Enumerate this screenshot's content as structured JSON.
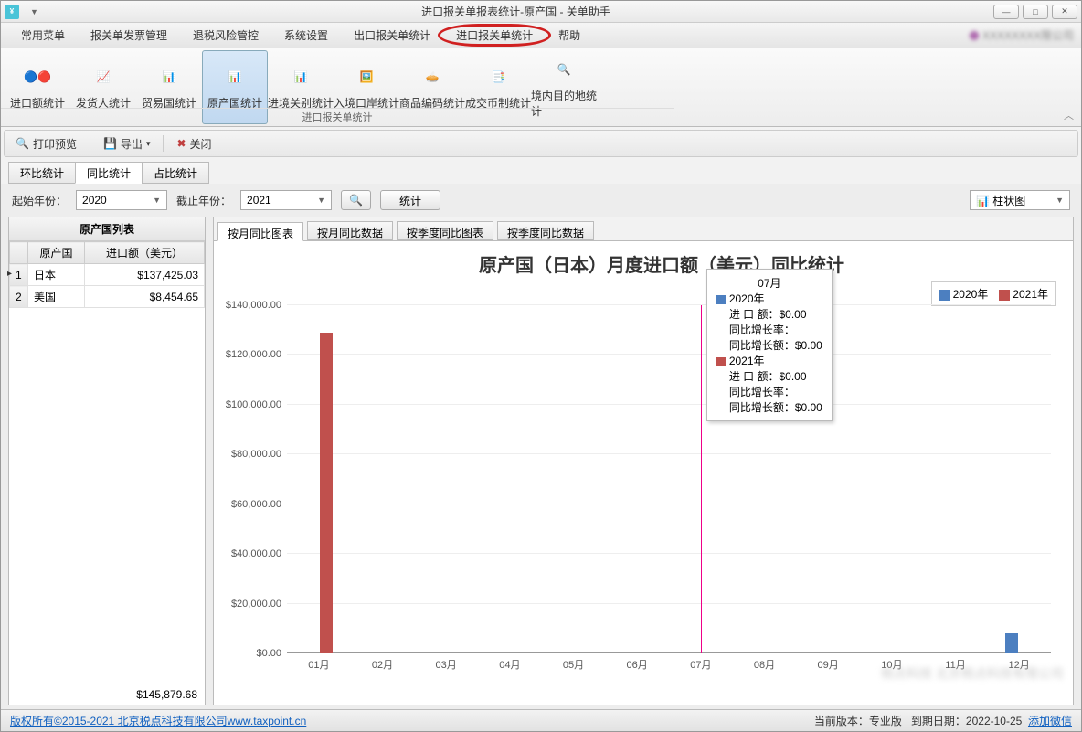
{
  "window": {
    "title": "进口报关单报表统计-原产国 - 关单助手"
  },
  "menubar": {
    "items": [
      "常用菜单",
      "报关单发票管理",
      "退税风险管控",
      "系统设置",
      "出口报关单统计",
      "进口报关单统计",
      "帮助"
    ],
    "highlight_index": 5,
    "company": "XXXXXXXX限公司"
  },
  "ribbon": {
    "buttons": [
      "进口额统计",
      "发货人统计",
      "贸易国统计",
      "原产国统计",
      "进境关别统计",
      "入境口岸统计",
      "商品编码统计",
      "成交币制统计",
      "境内目的地统计"
    ],
    "active_index": 3,
    "group_label": "进口报关单统计"
  },
  "toolbar": {
    "print": "打印预览",
    "export": "导出",
    "close": "关闭"
  },
  "tabs1": {
    "items": [
      "环比统计",
      "同比统计",
      "占比统计"
    ],
    "active": 1
  },
  "filter": {
    "start_label": "起始年份：",
    "start_value": "2020",
    "end_label": "截止年份：",
    "end_value": "2021",
    "stat_btn": "统计",
    "chart_type": "柱状图"
  },
  "left": {
    "title": "原产国列表",
    "col_country": "原产国",
    "col_amount": "进口额（美元）",
    "rows": [
      {
        "idx": "1",
        "country": "日本",
        "amount": "$137,425.03"
      },
      {
        "idx": "2",
        "country": "美国",
        "amount": "$8,454.65"
      }
    ],
    "total": "$145,879.68"
  },
  "tabs2": {
    "items": [
      "按月同比图表",
      "按月同比数据",
      "按季度同比图表",
      "按季度同比数据"
    ],
    "active": 0
  },
  "chart_data": {
    "type": "bar",
    "title": "原产国（日本）月度进口额（美元）同比统计",
    "categories": [
      "01月",
      "02月",
      "03月",
      "04月",
      "05月",
      "06月",
      "07月",
      "08月",
      "09月",
      "10月",
      "11月",
      "12月"
    ],
    "yticks": [
      "$0.00",
      "$20,000.00",
      "$40,000.00",
      "$60,000.00",
      "$80,000.00",
      "$100,000.00",
      "$120,000.00",
      "$140,000.00"
    ],
    "ylim": [
      0,
      140000
    ],
    "series": [
      {
        "name": "2020年",
        "color": "#4c7fc0",
        "values": [
          0,
          0,
          0,
          0,
          0,
          0,
          0,
          0,
          0,
          0,
          0,
          8000
        ]
      },
      {
        "name": "2021年",
        "color": "#c0504d",
        "values": [
          129000,
          0,
          0,
          0,
          0,
          0,
          0,
          0,
          0,
          0,
          0,
          0
        ]
      }
    ],
    "hover_index": 6,
    "tooltip": {
      "month": "07月",
      "rows": [
        {
          "year": "2020年",
          "amount_label": "进 口 额：",
          "amount": "$0.00",
          "rate_label": "同比增长率：",
          "rate": "",
          "diff_label": "同比增长额：",
          "diff": "$0.00",
          "color": "#4c7fc0"
        },
        {
          "year": "2021年",
          "amount_label": "进 口 额：",
          "amount": "$0.00",
          "rate_label": "同比增长率：",
          "rate": "",
          "diff_label": "同比增长额：",
          "diff": "$0.00",
          "color": "#c0504d"
        }
      ]
    }
  },
  "status": {
    "copyright": "版权所有©2015-2021 北京税点科技有限公司www.taxpoint.cn",
    "version_label": "当前版本：",
    "version": "专业版",
    "expire_label": "到期日期：",
    "expire": "2022-10-25",
    "wechat": "添加微信"
  }
}
